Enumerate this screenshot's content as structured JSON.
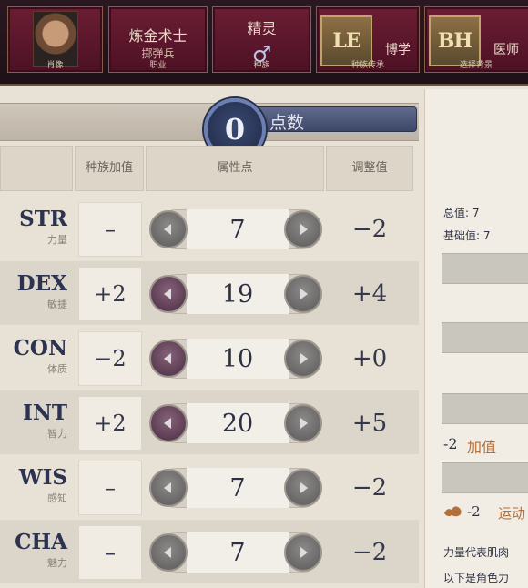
{
  "tabs": [
    {
      "label": "肖像"
    },
    {
      "label": "职业",
      "title": "炼金术士",
      "subtitle": "掷弹兵"
    },
    {
      "label": "种族",
      "title": "精灵",
      "icon": "male-symbol-icon"
    },
    {
      "label": "种族传承",
      "icon_text": "LE",
      "trait": "博学"
    },
    {
      "label": "选择背景",
      "icon_text": "BH",
      "trait": "医师"
    }
  ],
  "points": {
    "value": "0",
    "label": "点数"
  },
  "table": {
    "headers": {
      "racial": "种族加值",
      "score": "属性点",
      "modifier": "调整值"
    },
    "rows": [
      {
        "abbr": "STR",
        "name": "力量",
        "bonus": "–",
        "score": "7",
        "mod": "−2",
        "dec_active": false
      },
      {
        "abbr": "DEX",
        "name": "敏捷",
        "bonus": "+2",
        "score": "19",
        "mod": "+4",
        "dec_active": true
      },
      {
        "abbr": "CON",
        "name": "体质",
        "bonus": "−2",
        "score": "10",
        "mod": "+0",
        "dec_active": true
      },
      {
        "abbr": "INT",
        "name": "智力",
        "bonus": "+2",
        "score": "20",
        "mod": "+5",
        "dec_active": true
      },
      {
        "abbr": "WIS",
        "name": "感知",
        "bonus": "–",
        "score": "7",
        "mod": "−2",
        "dec_active": false
      },
      {
        "abbr": "CHA",
        "name": "魅力",
        "bonus": "–",
        "score": "7",
        "mod": "−2",
        "dec_active": false
      }
    ]
  },
  "right_panel": {
    "total": "总值: 7",
    "base": "基础值: 7",
    "bonus_value": "-2",
    "bonus_label": "加值",
    "skill_value": "-2",
    "skill_label": "运动",
    "desc_line1": "力量代表肌肉",
    "desc_line2": "以下是角色力"
  },
  "colors": {
    "tile": "#5e1730",
    "accent_blue": "#3e4768",
    "ink": "#2c2f45",
    "orange": "#b4703a"
  }
}
